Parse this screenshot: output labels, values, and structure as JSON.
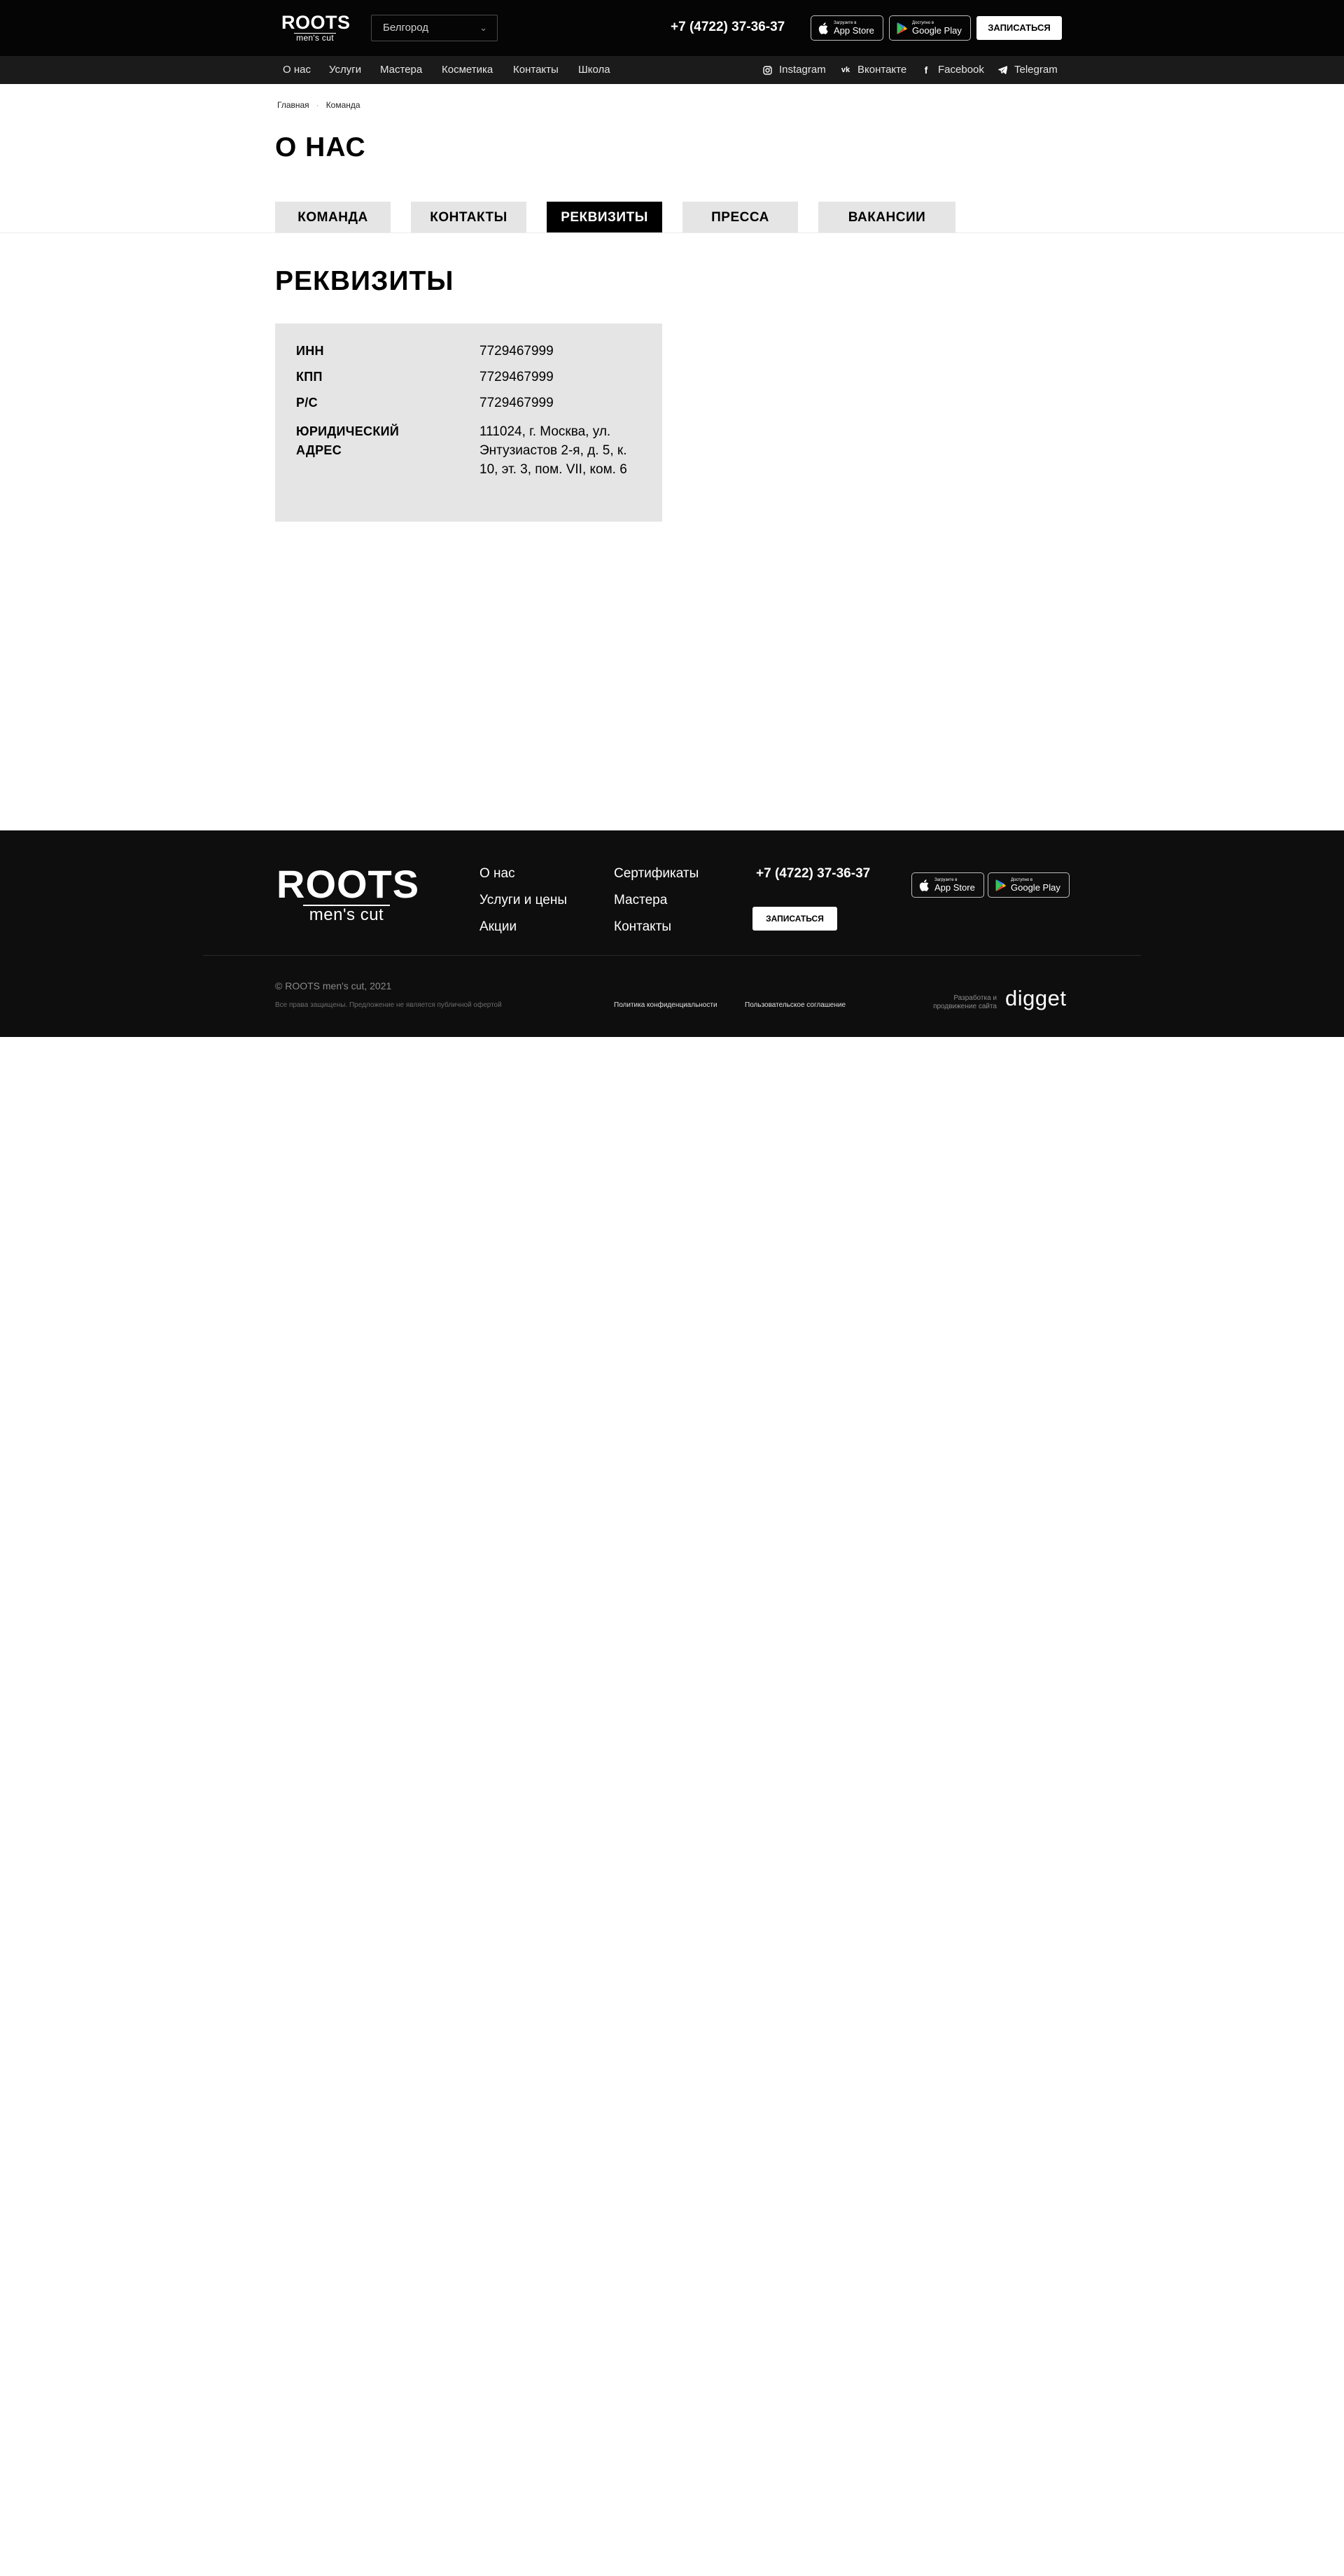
{
  "header": {
    "logo_main": "ROOTS",
    "logo_sub": "men's cut",
    "city": "Белгород",
    "phone": "+7 (4722) 37-36-37",
    "app_store_small": "Загрузите в",
    "app_store_big": "App Store",
    "google_play_small": "Доступно в",
    "google_play_big": "Google Play",
    "cta": "ЗАПИСАТЬСЯ"
  },
  "nav": {
    "items": [
      "О нас",
      "Услуги",
      "Мастера",
      "Косметика",
      "Контакты",
      "Школа"
    ],
    "social": [
      {
        "label": "Instagram",
        "icon": "instagram-icon"
      },
      {
        "label": "Вконтакте",
        "icon": "vk-icon"
      },
      {
        "label": "Facebook",
        "icon": "facebook-icon"
      },
      {
        "label": "Telegram",
        "icon": "telegram-icon"
      }
    ]
  },
  "breadcrumbs": [
    "Главная",
    "Команда"
  ],
  "page_title": "О НАС",
  "tabs": [
    {
      "label": "КОМАНДА",
      "active": false
    },
    {
      "label": "КОНТАКТЫ",
      "active": false
    },
    {
      "label": "РЕКВИЗИТЫ",
      "active": true
    },
    {
      "label": "ПРЕССА",
      "active": false
    },
    {
      "label": "ВАКАНСИИ",
      "active": false
    }
  ],
  "section_title": "РЕКВИЗИТЫ",
  "requisites": [
    {
      "key": "ИНН",
      "value": "7729467999"
    },
    {
      "key": "КПП",
      "value": "7729467999"
    },
    {
      "key": "Р/С",
      "value": "7729467999"
    },
    {
      "key": "ЮРИДИЧЕСКИЙ АДРЕС",
      "value": "111024, г. Москва, ул. Энтузиастов 2-я, д. 5, к. 10, эт. 3, пом. VII, ком. 6"
    }
  ],
  "footer": {
    "logo_main": "ROOTS",
    "logo_sub": "men's cut",
    "links_col1": [
      "О нас",
      "Услуги и цены",
      "Акции"
    ],
    "links_col2": [
      "Сертификаты",
      "Мастера",
      "Контакты"
    ],
    "phone": "+7 (4722) 37-36-37",
    "cta": "ЗАПИСАТЬСЯ",
    "copyright": "© ROOTS men's cut, 2021",
    "rights_note": "Все права защищены. Предложение не является публичной офертой",
    "privacy": "Политика конфиденциальности",
    "agreement": "Пользовательское соглашение",
    "dev_line1": "Разработка и",
    "dev_line2": "продвижение сайта",
    "dev_brand": "digget"
  },
  "colors": {
    "header_bg": "#050505",
    "nav_bg": "#1b1b1b",
    "tab_bg": "#e5e5e5",
    "tab_active_bg": "#000000",
    "card_bg": "#e5e5e5",
    "footer_bg": "#0e0e0e"
  }
}
